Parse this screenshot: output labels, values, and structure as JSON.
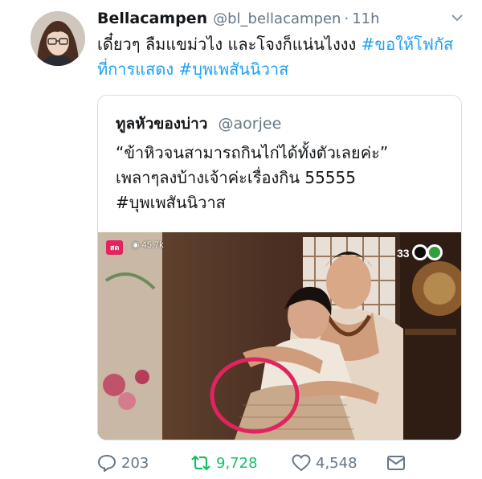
{
  "tweet": {
    "display_name": "Bellacampen",
    "handle": "@bl_bellacampen",
    "separator": "·",
    "time": "11h",
    "text_plain": "เดี๋ยวๆ ลืมแขม่วไง และโจงก็แน่นไงงง ",
    "text_hashtag1": "#ขอให้โฟกัสที่การแสดง",
    "text_hashtag2": "#บุพเพสันนิวาส"
  },
  "quoted_tweet": {
    "display_name": "ทูลหัวของบ่าว",
    "handle": "@aorjee",
    "line1": "“ข้าหิวจนสามารถกินไก่ได้ทั้งตัวเลยค่ะ”",
    "line2": "เพลาๆลงบ้างเจ้าค่ะเรื่องกิน 55555",
    "line3": "#บุพเพสันนิวาส",
    "media": {
      "live_badge": "สด",
      "views": "45.7k",
      "channel": "33"
    }
  },
  "actions": {
    "replies": "203",
    "retweets": "9,728",
    "likes": "4,548"
  },
  "colors": {
    "link": "#1da1f2",
    "retweet_active": "#17bf63",
    "muted": "#657786",
    "highlight_circle": "#e0245e"
  }
}
